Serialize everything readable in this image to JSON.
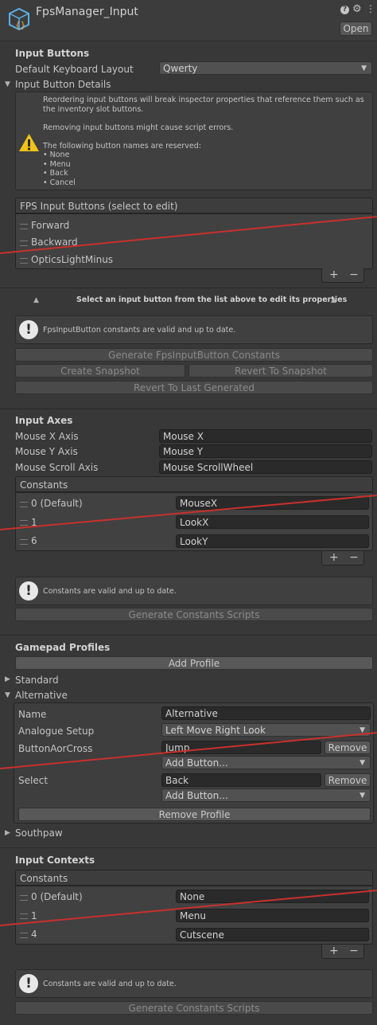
{
  "header": {
    "title": "FpsManager_Input",
    "open_label": "Open"
  },
  "input_buttons": {
    "section_title": "Input Buttons",
    "layout_label": "Default Keyboard Layout",
    "layout_value": "Qwerty",
    "details_label": "Input Button Details",
    "warning_lines": [
      "Reordering input buttons will break inspector properties that reference them such as",
      "the inventory slot buttons.",
      "",
      "Removing input buttons might cause script errors.",
      "",
      "The following button names are reserved:",
      "• None",
      "• Menu",
      "• Back",
      "• Cancel"
    ],
    "list_title": "FPS Input Buttons (select to edit)",
    "items": [
      "Forward",
      "Backward",
      "OpticsLightMinus"
    ],
    "select_hint": "Select an input button from the list above to edit its properties",
    "status_message": "FpsInputButton constants are valid and up to date.",
    "generate_label": "Generate FpsInputButton Constants",
    "create_snapshot_label": "Create Snapshot",
    "revert_snapshot_label": "Revert To Snapshot",
    "revert_generated_label": "Revert To Last Generated"
  },
  "input_axes": {
    "section_title": "Input Axes",
    "fields": [
      {
        "label": "Mouse X Axis",
        "value": "Mouse X"
      },
      {
        "label": "Mouse Y Axis",
        "value": "Mouse Y"
      },
      {
        "label": "Mouse Scroll Axis",
        "value": "Mouse ScrollWheel"
      }
    ],
    "constants_title": "Constants",
    "constants": [
      {
        "index": "0 (Default)",
        "value": "MouseX"
      },
      {
        "index": "1",
        "value": "LookX"
      },
      {
        "index": "6",
        "value": "LookY"
      }
    ],
    "status_message": "Constants are valid and up to date.",
    "generate_label": "Generate Constants Scripts"
  },
  "gamepad": {
    "section_title": "Gamepad Profiles",
    "add_profile_label": "Add Profile",
    "profiles": [
      "Standard",
      "Alternative",
      "Southpaw"
    ],
    "name_label": "Name",
    "name_value": "Alternative",
    "analogue_label": "Analogue Setup",
    "analogue_value": "Left Move Right Look",
    "button_a_label": "ButtonAorCross",
    "button_a_value": "Jump",
    "select_label": "Select",
    "select_value": "Back",
    "remove_label": "Remove",
    "add_button_label": "Add Button...",
    "remove_profile_label": "Remove Profile"
  },
  "input_contexts": {
    "section_title": "Input Contexts",
    "constants_title": "Constants",
    "constants": [
      {
        "index": "0 (Default)",
        "value": "None"
      },
      {
        "index": "1",
        "value": "Menu"
      },
      {
        "index": "4",
        "value": "Cutscene"
      }
    ],
    "status_message": "Constants are valid and up to date.",
    "generate_label": "Generate Constants Scripts"
  },
  "colors": {
    "background": "#383838",
    "annotation_red": "#c9302c",
    "warning_yellow": "#f0c419",
    "icon_blue": "#5ab0e6"
  },
  "icons": [
    "script-asset-icon",
    "help-icon",
    "settings-icon",
    "menu-icon",
    "warning-icon",
    "info-icon",
    "add-icon",
    "remove-icon",
    "foldout-arrow-icon"
  ]
}
